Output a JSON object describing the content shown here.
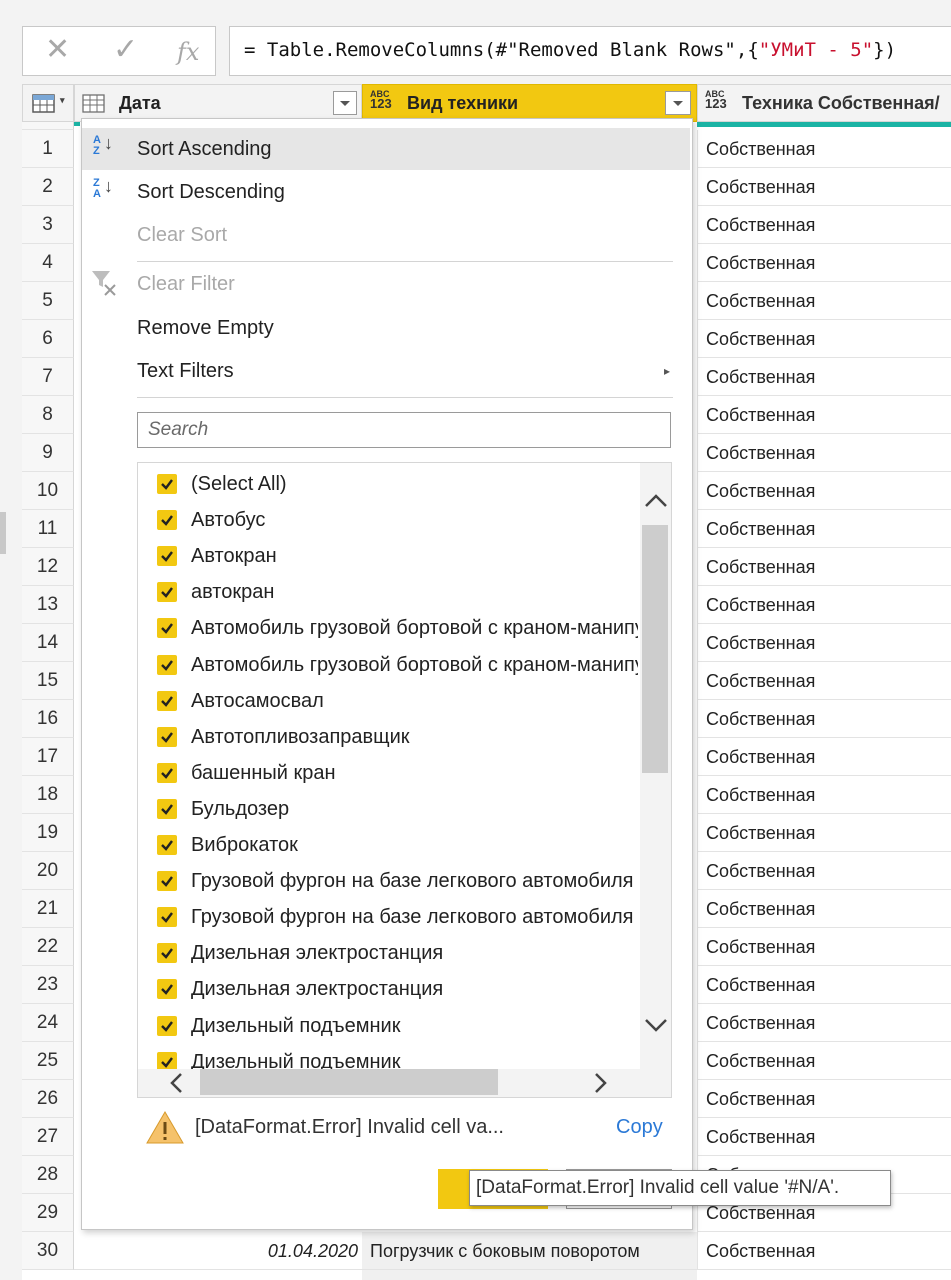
{
  "formula_bar": {
    "cancel_icon": "close-icon",
    "confirm_icon": "check-icon",
    "fx_label": "fx",
    "prefix": "= Table.RemoveColumns(#\"Removed Blank Rows\",{",
    "string_arg": "\"УМиТ - 5\"",
    "suffix": "})"
  },
  "grid": {
    "columns": [
      {
        "type_badge": "table-icon",
        "name": "Дата"
      },
      {
        "type_badge_top": "ABC",
        "type_badge_bottom": "123",
        "name": "Вид техники"
      },
      {
        "type_badge_top": "ABC",
        "type_badge_bottom": "123",
        "name": "Техника Собственная/"
      }
    ],
    "row_numbers": [
      "1",
      "2",
      "3",
      "4",
      "5",
      "6",
      "7",
      "8",
      "9",
      "10",
      "11",
      "12",
      "13",
      "14",
      "15",
      "16",
      "17",
      "18",
      "19",
      "20",
      "21",
      "22",
      "23",
      "24",
      "25",
      "26",
      "27",
      "28",
      "29",
      "30"
    ],
    "column_c_values": [
      "Собственная",
      "Собственная",
      "Собственная",
      "Собственная",
      "Собственная",
      "Собственная",
      "Собственная",
      "Собственная",
      "Собственная",
      "Собственная",
      "Собственная",
      "Собственная",
      "Собственная",
      "Собственная",
      "Собственная",
      "Собственная",
      "Собственная",
      "Собственная",
      "Собственная",
      "Собственная",
      "Собственная",
      "Собственная",
      "Собственная",
      "Собственная",
      "Собственная",
      "Собственная",
      "Собственная",
      "Собственная",
      "Собственная",
      "Собственная"
    ],
    "row30": {
      "date": "01.04.2020",
      "type": "Погрузчик с боковым поворотом"
    }
  },
  "dropdown": {
    "sort_ascending": "Sort Ascending",
    "sort_descending": "Sort Descending",
    "clear_sort": "Clear Sort",
    "clear_filter": "Clear Filter",
    "remove_empty": "Remove Empty",
    "text_filters": "Text Filters",
    "search_placeholder": "Search",
    "values": [
      "(Select All)",
      "Автобус",
      "Автокран",
      "автокран",
      "Автомобиль грузовой бортовой с краном-манипулятором",
      "Автомобиль грузовой бортовой с краном-манипулятором",
      "Автосамосвал",
      "Автотопливозаправщик",
      "башенный кран",
      "Бульдозер",
      "Виброкаток",
      "Грузовой фургон на базе легкового автомобиля",
      "Грузовой фургон на базе легкового автомобиля",
      "Дизельная электростанция",
      "Дизельная электростанция",
      "Дизельный подъемник",
      "Дизельный подъемник"
    ],
    "error_text": "[DataFormat.Error] Invalid cell va...",
    "copy_label": "Copy"
  },
  "tooltip": {
    "text": "[DataFormat.Error] Invalid cell value '#N/A'."
  },
  "colors": {
    "accent_yellow": "#f2c811",
    "link_blue": "#2b79d6",
    "teal_underline": "#1bb3a4"
  }
}
